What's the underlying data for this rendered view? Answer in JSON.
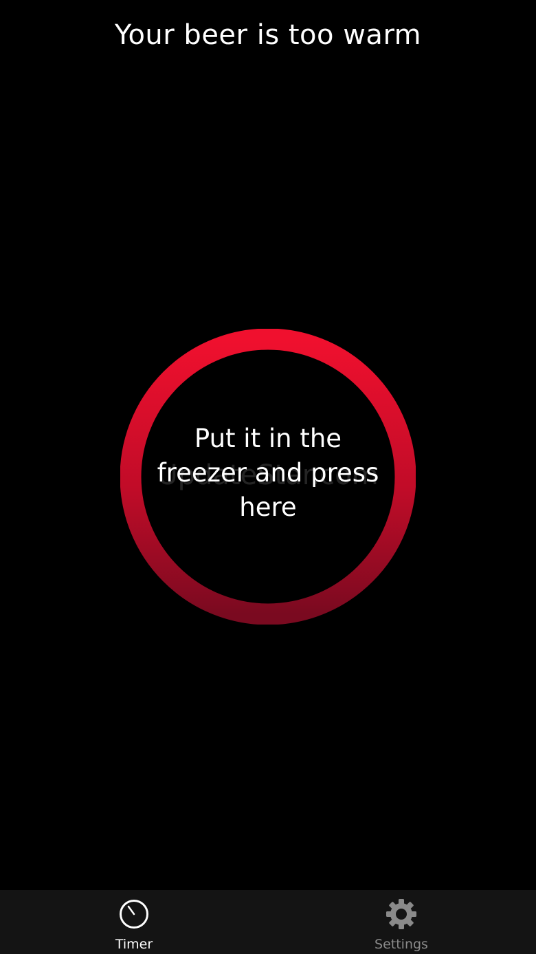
{
  "header": {
    "title": "Your beer is too warm"
  },
  "main": {
    "button_text": "Put it in the freezer and press here",
    "watermark": "UpdateStar.com"
  },
  "tabs": [
    {
      "label": "Timer",
      "icon": "timer-icon",
      "active": true
    },
    {
      "label": "Settings",
      "icon": "gear-icon",
      "active": false
    }
  ],
  "colors": {
    "background": "#000000",
    "ring_top": "#f0102e",
    "ring_bottom": "#7a0a20",
    "tab_bar": "#141414",
    "active_label": "#ffffff",
    "inactive_label": "#8a8a8a"
  }
}
